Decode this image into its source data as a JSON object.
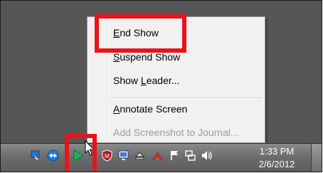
{
  "context_menu": {
    "items": [
      {
        "label_prefix": "",
        "mnemonic": "E",
        "label_rest": "nd Show",
        "enabled": true,
        "highlighted": true
      },
      {
        "label_prefix": "",
        "mnemonic": "S",
        "label_rest": "uspend Show",
        "enabled": true
      },
      {
        "label_prefix": "Show ",
        "mnemonic": "L",
        "label_rest": "eader...",
        "enabled": true
      },
      {
        "label_prefix": "",
        "mnemonic": "A",
        "label_rest": "nnotate Screen",
        "enabled": true
      },
      {
        "label_prefix": "Add Screenshot to Journal...",
        "mnemonic": "",
        "label_rest": "",
        "enabled": false
      }
    ]
  },
  "taskbar": {
    "tray_icons": [
      "network-monitor-icon",
      "teamviewer-icon",
      "play-show-icon",
      "antivirus-shield-icon",
      "display-icon",
      "eject-device-icon",
      "acrobat-icon",
      "action-center-flag-icon",
      "network-icon",
      "volume-icon"
    ],
    "clock": {
      "time": "1:33 PM",
      "date": "2/6/2012"
    }
  },
  "colors": {
    "highlight_border": "#e8141b",
    "desktop": "#565656",
    "menu_background": "#f1f1f1"
  }
}
